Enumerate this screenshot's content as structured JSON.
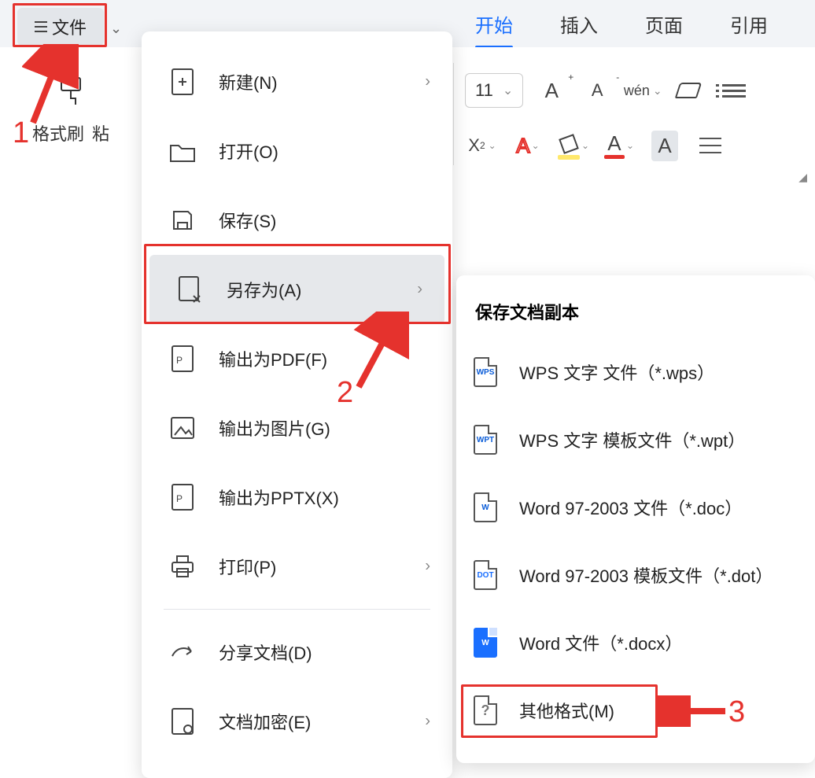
{
  "header": {
    "file_button": "文件",
    "tabs": {
      "start": "开始",
      "insert": "插入",
      "page": "页面",
      "cite": "引用"
    }
  },
  "ribbon": {
    "format_brush": "格式刷",
    "paste_prefix": "粘",
    "font_size": "11",
    "a_plus": "A",
    "a_plus_sup": "+",
    "a_minus": "A",
    "a_minus_sup": "-",
    "wen": "wén",
    "x2": "X",
    "x2_sup": "2",
    "A_outline": "A",
    "A_highlight": "A",
    "A_color": "A",
    "A_box": "A"
  },
  "menu": {
    "new": "新建(N)",
    "open": "打开(O)",
    "save": "保存(S)",
    "save_as": "另存为(A)",
    "export_pdf": "输出为PDF(F)",
    "export_img": "输出为图片(G)",
    "export_pptx": "输出为PPTX(X)",
    "print": "打印(P)",
    "share": "分享文档(D)",
    "encrypt": "文档加密(E)"
  },
  "submenu": {
    "title": "保存文档副本",
    "wps": "WPS 文字 文件（*.wps）",
    "wpt": "WPS 文字 模板文件（*.wpt）",
    "doc": "Word 97-2003 文件（*.doc）",
    "dot": "Word 97-2003 模板文件（*.dot）",
    "docx": "Word 文件（*.docx）",
    "other": "其他格式(M)",
    "icons": {
      "wps": "WPS",
      "wpt": "WPT",
      "w": "W",
      "dot": "DOT",
      "q": "?"
    }
  },
  "annotations": {
    "n1": "1",
    "n2": "2",
    "n3": "3"
  }
}
